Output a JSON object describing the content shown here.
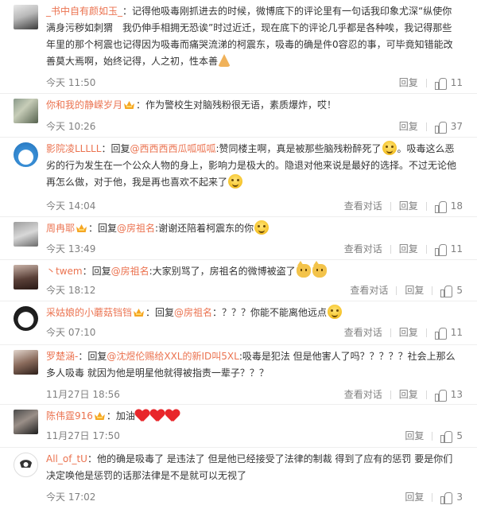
{
  "actions": {
    "reply": "回复",
    "view_dialog": "查看对话"
  },
  "comments": [
    {
      "user": "_书中自有颜如玉_",
      "text": "：记得他吸毒刚抓进去的时候，微博底下的评论里有一句话我印象尤深“纵使你满身污秽如刺猬　我仍伸手相拥无恐诶”时过近迁，现在底下的评论几乎都是各种唉，我记得那些年里的那个柯震也记得因为吸毒而痛哭流涕的柯震东，吸毒的确是件0容忍的事，可毕竟知错能改善莫大焉啊，始终记得，人之初，性本善",
      "time": "今天 11:50",
      "likes": "11"
    },
    {
      "user": "你和我的静嵘岁月",
      "text": "：作为警校生对脑残粉很无语，素质爆炸，哎！",
      "time": "今天 10:26",
      "likes": "37"
    },
    {
      "user": "影院凌LLLLL",
      "pre": "：回复",
      "mention": "@西西西西瓜呱呱呱",
      "text": ":赞同楼主啊，真是被那些脑残粉醉死了",
      "text2": "。吸毒这么恶劣的行为发生在一个公众人物的身上，影响力是极大的。隐退对他来说是最好的选择。不过无论他再怎么做，对于他，我是再也喜欢不起来了",
      "time": "今天 14:04",
      "likes": "18"
    },
    {
      "user": "周冉耶",
      "pre": "：回复",
      "mention": "@房祖名",
      "text": ":谢谢还陪着柯震东的你",
      "time": "今天 13:49",
      "likes": "11"
    },
    {
      "user": "丶twem",
      "pre": "：回复",
      "mention": "@房祖名",
      "text": ":大家别骂了，房祖名的微博被盗了",
      "time": "今天 18:12",
      "likes": "5"
    },
    {
      "user": "采姑娘的小蘑菇铛铛",
      "pre": "：回复",
      "mention": "@房祖名",
      "text": "：？？？你能不能离他远点",
      "time": "今天 07:10",
      "likes": "11"
    },
    {
      "user": "罗楚涵-",
      "pre": "：回复",
      "mention": "@沈煜伦赐给XXL的新ID叫5XL",
      "text": ":吸毒是犯法 但是他害人了吗？？？？？社会上那么多人吸毒 就因为他是明星他就得被指责一辈子？？？",
      "time": "11月27日 18:56",
      "likes": "13"
    },
    {
      "user": "陈伟霆916",
      "text": "：加油",
      "time": "11月27日 17:50",
      "likes": "5"
    },
    {
      "user": "All_of_tU",
      "text": "：他的确是吸毒了 是违法了 但是他已经接受了法律的制裁 得到了应有的惩罚 要是你们决定唤他是惩罚的话那法律是不是就可以无视了",
      "time": "今天 17:02",
      "likes": "3"
    }
  ]
}
